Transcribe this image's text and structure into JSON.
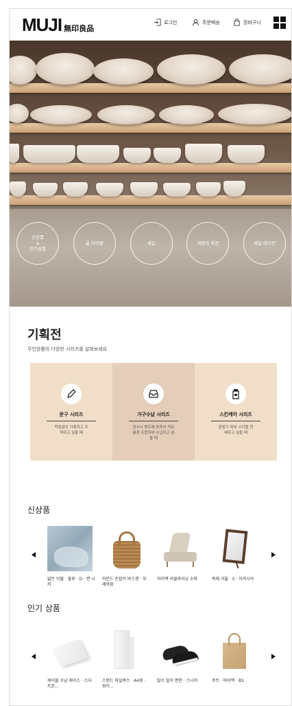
{
  "header": {
    "logo_brand": "MUJI",
    "logo_kr": "無印良品",
    "login_label": "로그인",
    "order_label": "주문배송",
    "cart_label": "장바구니"
  },
  "hero": {
    "circles": [
      {
        "label": "신상품\n&\n인기상품"
      },
      {
        "label": "룸 아이템"
      },
      {
        "label": "세일"
      },
      {
        "label": "계절의 추천"
      },
      {
        "label": "메일 매거진"
      }
    ]
  },
  "exhibition": {
    "title": "기획전",
    "subtitle": "무인양품의 다양한 시리즈를 살펴보세요",
    "cards": [
      {
        "title": "문구 시리즈",
        "desc": "막힘없이 기록하고 주\n역하고 싶을 때",
        "icon": "pencil-icon",
        "bg": "#f1dec8"
      },
      {
        "title": "가구수납 시리즈",
        "desc": "정수나 용도에 맞추어 자유\n롭게 조합하여 수납하고 싶\n을 때",
        "icon": "storage-tray-icon",
        "bg": "#e4cdb9"
      },
      {
        "title": "스킨케어 시리즈",
        "desc": "깜빛기 피부 시각을 한\n배우고 싶을 때",
        "icon": "skincare-bottle-icon",
        "bg": "#f1dec8"
      }
    ]
  },
  "new_products": {
    "title": "신상품",
    "items": [
      {
        "name": "얇은 이불 · 블루 · D · 면 시커"
      },
      {
        "name": "라운드 손잡이 바스켓 · 부레옥잠"
      },
      {
        "name": "하이백 리클라이닝 소파"
      },
      {
        "name": "목제 거울 · S · 아카시아"
      }
    ]
  },
  "popular_products": {
    "title": "인기 상품",
    "items": [
      {
        "name": "케이블 수납 케이스 · 스다트본..."
      },
      {
        "name": "스탠드 파일박스 · A4용 · 화이..."
      },
      {
        "name": "발수 발이 편한 · 스니커"
      },
      {
        "name": "주트 · 마이백 · B5"
      }
    ]
  }
}
